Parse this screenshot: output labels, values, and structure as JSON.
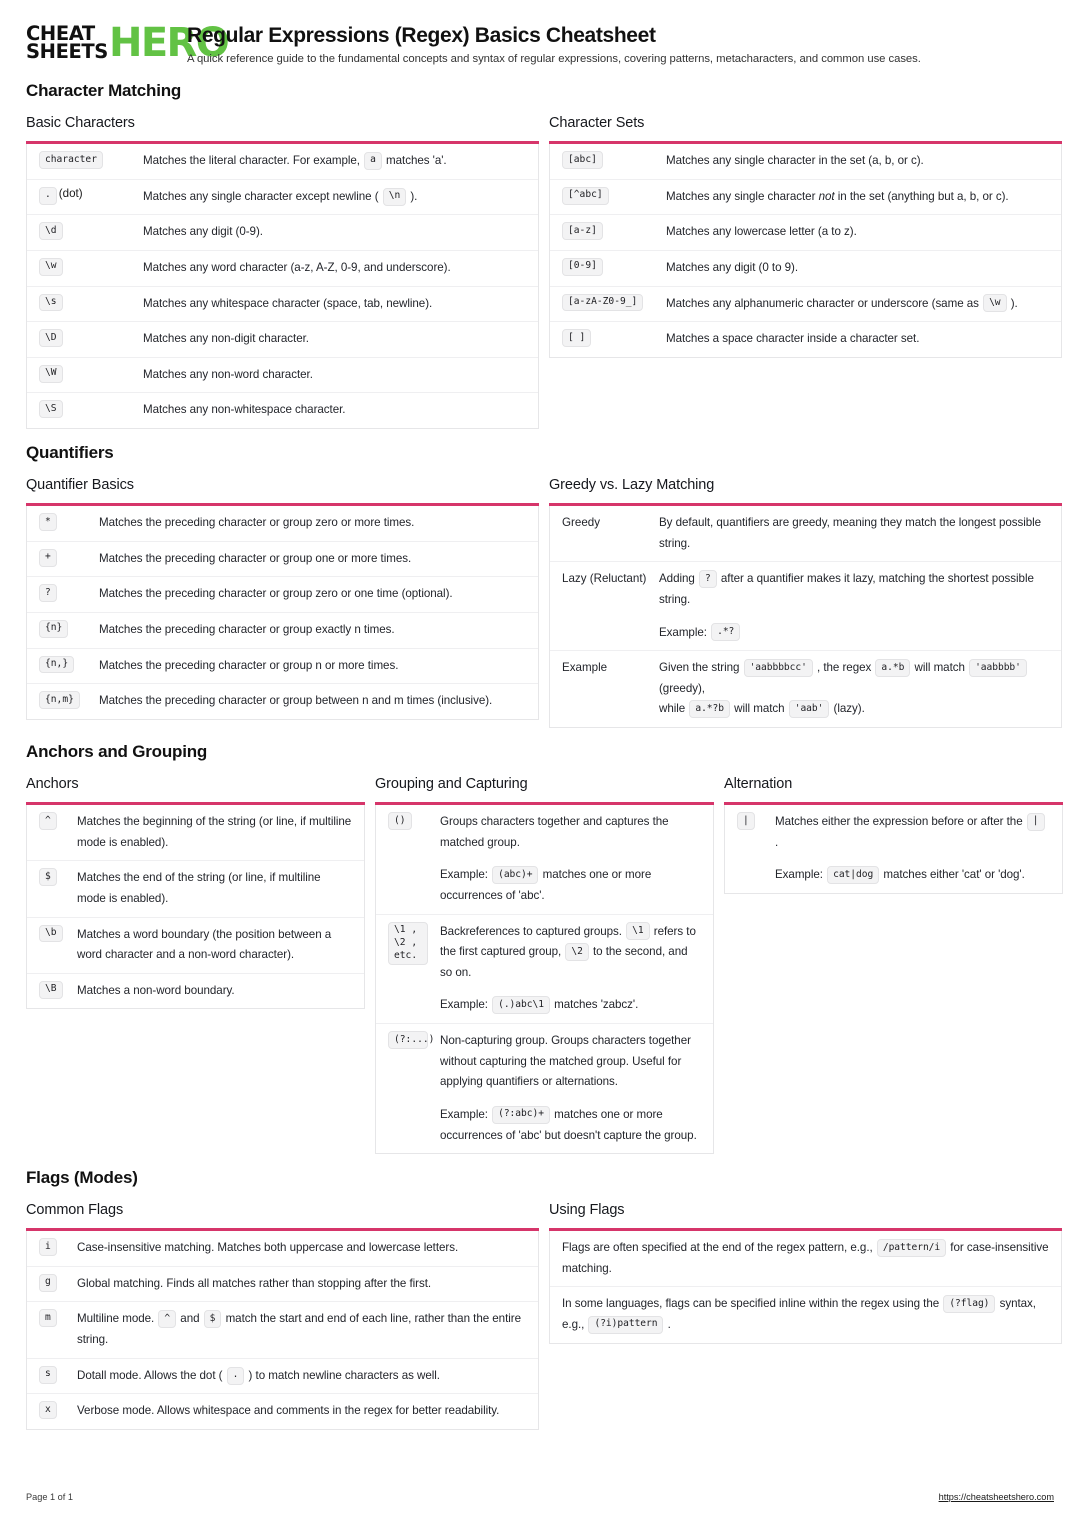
{
  "brand": {
    "line1": "CHEAT",
    "line2": "SHEETS",
    "hero": "HERO",
    "green": "#62c244"
  },
  "header": {
    "title": "Regular Expressions (Regex) Basics Cheatsheet",
    "subtitle": "A quick reference guide to the fundamental concepts and syntax of regular expressions, covering patterns, metacharacters, and common use cases."
  },
  "accent_color": "#d6356a",
  "sections": [
    {
      "title": "Character Matching",
      "cards": [
        {
          "title": "Basic Characters",
          "rows": [
            {
              "key": "character",
              "desc_pre": "Matches the literal character. For example, ",
              "chip": "a",
              "desc_post": " matches 'a'."
            },
            {
              "key": ".",
              "key_suffix": " (dot)",
              "desc_pre": "Matches any single character except newline ( ",
              "chip": "\\n",
              "desc_post": " )."
            },
            {
              "key": "\\d",
              "desc_pre": "Matches any digit (0-9)."
            },
            {
              "key": "\\w",
              "desc_pre": "Matches any word character (a-z, A-Z, 0-9, and underscore)."
            },
            {
              "key": "\\s",
              "desc_pre": "Matches any whitespace character (space, tab, newline)."
            },
            {
              "key": "\\D",
              "desc_pre": "Matches any non-digit character."
            },
            {
              "key": "\\W",
              "desc_pre": "Matches any non-word character."
            },
            {
              "key": "\\S",
              "desc_pre": "Matches any non-whitespace character."
            }
          ]
        },
        {
          "title": "Character Sets",
          "rows": [
            {
              "key": "[abc]",
              "desc_pre": "Matches any single character in the set (a, b, or c)."
            },
            {
              "key": "[^abc]",
              "desc_pre": "Matches any single character ",
              "em": "not",
              "desc_mid": " in the set (anything but a, b, or c)."
            },
            {
              "key": "[a-z]",
              "desc_pre": "Matches any lowercase letter (a to z)."
            },
            {
              "key": "[0-9]",
              "desc_pre": "Matches any digit (0 to 9)."
            },
            {
              "key": "[a-zA-Z0-9_]",
              "desc_pre": "Matches any alphanumeric character or underscore (same as ",
              "chip": "\\w",
              "desc_post": " )."
            },
            {
              "key": "[ ]",
              "desc_pre": "Matches a space character inside a character set."
            }
          ]
        }
      ]
    },
    {
      "title": "Quantifiers",
      "cards": [
        {
          "title": "Quantifier Basics",
          "rows": [
            {
              "key": "*",
              "desc_pre": "Matches the preceding character or group zero or more times."
            },
            {
              "key": "+",
              "desc_pre": "Matches the preceding character or group one or more times."
            },
            {
              "key": "?",
              "desc_pre": "Matches the preceding character or group zero or one time (optional)."
            },
            {
              "key": "{n}",
              "desc_pre": "Matches the preceding character or group exactly n times."
            },
            {
              "key": "{n,}",
              "desc_pre": "Matches the preceding character or group n or more times."
            },
            {
              "key": "{n,m}",
              "desc_pre": "Matches the preceding character or group between n and m times (inclusive)."
            }
          ]
        },
        {
          "title": "Greedy vs. Lazy Matching",
          "rows": [
            {
              "label": "Greedy",
              "desc_pre": "By default, quantifiers are greedy, meaning they match the longest possible string."
            },
            {
              "label": "Lazy (Reluctant)",
              "desc_pre": "Adding ",
              "chip": "?",
              "desc_post": " after a quantifier makes it lazy, matching the shortest possible string.",
              "example_label": "Example: ",
              "example_chip": ".*?"
            },
            {
              "label": "Example",
              "desc_pre": "Given the string ",
              "chip": "'aabbbbcc'",
              "desc_post": " , the regex ",
              "chip2": "a.*b",
              "desc_post2": " will match ",
              "chip3": "'aabbbb'",
              "desc_post3": " (greedy),",
              "line2_pre": "while ",
              "line2_chip": "a.*?b",
              "line2_mid": " will match ",
              "line2_chip2": "'aab'",
              "line2_post": " (lazy)."
            }
          ]
        }
      ]
    },
    {
      "title": "Anchors and Grouping",
      "cards": [
        {
          "title": "Anchors",
          "rows": [
            {
              "key": "^",
              "desc_pre": "Matches the beginning of the string (or line, if multiline mode is enabled)."
            },
            {
              "key": "$",
              "desc_pre": "Matches the end of the string (or line, if multiline mode is enabled)."
            },
            {
              "key": "\\b",
              "desc_pre": "Matches a word boundary (the position between a word character and a non-word character)."
            },
            {
              "key": "\\B",
              "desc_pre": "Matches a non-word boundary."
            }
          ]
        },
        {
          "title": "Grouping and Capturing",
          "rows": [
            {
              "key": "()",
              "desc_pre": "Groups characters together and captures the matched group.",
              "example_label": "Example: ",
              "example_chip": "(abc)+",
              "example_post": " matches one or more occurrences of 'abc'."
            },
            {
              "key": "\\1 , \\2 , etc.",
              "desc_pre": "Backreferences to captured groups. ",
              "chip": "\\1",
              "desc_post": " refers to the first captured group, ",
              "chip2": "\\2",
              "desc_post2": " to the second, and so on.",
              "example_label": "Example: ",
              "example_chip": "(.)abc\\1",
              "example_post": " matches 'zabcz'."
            },
            {
              "key": "(?:...)",
              "desc_pre": "Non-capturing group. Groups characters together without capturing the matched group. Useful for applying quantifiers or alternations.",
              "example_label": "Example: ",
              "example_chip": "(?:abc)+",
              "example_post": " matches one or more occurrences of 'abc' but doesn't capture the group."
            }
          ]
        },
        {
          "title": "Alternation",
          "rows": [
            {
              "key": "|",
              "desc_pre": "Matches either the expression before or after the ",
              "chip": "|",
              "desc_post": " .",
              "example_label": "Example: ",
              "example_chip": "cat|dog",
              "example_post": " matches either 'cat' or 'dog'."
            }
          ]
        }
      ]
    },
    {
      "title": "Flags (Modes)",
      "cards": [
        {
          "title": "Common Flags",
          "rows": [
            {
              "key": "i",
              "desc_pre": "Case-insensitive matching. Matches both uppercase and lowercase letters."
            },
            {
              "key": "g",
              "desc_pre": "Global matching. Finds all matches rather than stopping after the first."
            },
            {
              "key": "m",
              "desc_pre": "Multiline mode. ",
              "chip": "^",
              "desc_post": " and ",
              "chip2": "$",
              "desc_post2": " match the start and end of each line, rather than the entire string."
            },
            {
              "key": "s",
              "desc_pre": "Dotall mode. Allows the dot ( ",
              "chip": ".",
              "desc_post": " ) to match newline characters as well."
            },
            {
              "key": "x",
              "desc_pre": "Verbose mode. Allows whitespace and comments in the regex for better readability."
            }
          ]
        },
        {
          "title": "Using Flags",
          "rows": [
            {
              "desc_pre": "Flags are often specified at the end of the regex pattern, e.g., ",
              "chip": "/pattern/i",
              "desc_post": " for case-insensitive matching."
            },
            {
              "desc_pre": "In some languages, flags can be specified inline within the regex using the ",
              "chip": "(?flag)",
              "desc_post": " syntax, e.g., ",
              "chip2": "(?i)pattern",
              "desc_post2": " ."
            }
          ]
        }
      ]
    }
  ],
  "footer": {
    "page": "Page 1 of 1",
    "url": "https://cheatsheetshero.com"
  }
}
